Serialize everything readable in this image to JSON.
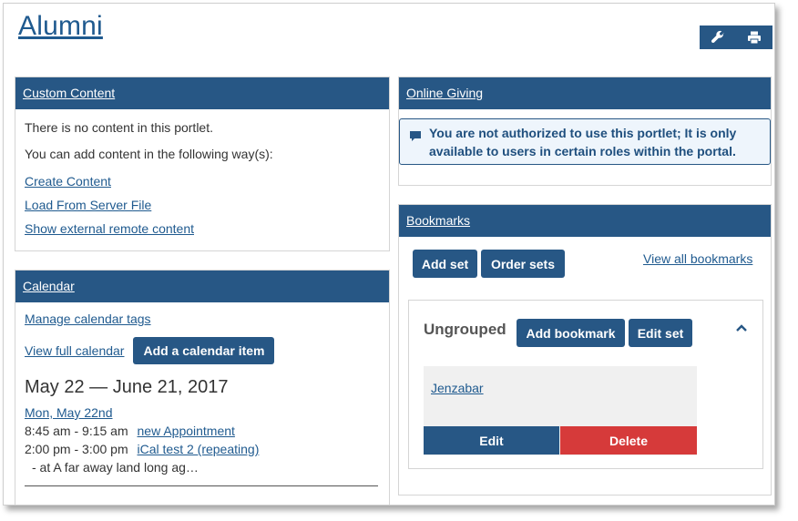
{
  "page": {
    "title": "Alumni"
  },
  "tools": {
    "wrench_icon": "wrench-icon",
    "print_icon": "print-icon"
  },
  "custom_content": {
    "header": "Custom Content",
    "no_content": "There is no content in this portlet.",
    "add_ways": "You can add content in the following way(s):",
    "links": [
      "Create Content",
      "Load From Server File",
      "Show external remote content"
    ]
  },
  "calendar": {
    "header": "Calendar",
    "manage_tags": "Manage calendar tags",
    "view_full": "View full calendar",
    "add_item": "Add a calendar item",
    "range": "May 22 — June 21, 2017",
    "day": "Mon, May 22nd",
    "events": [
      {
        "time": "8:45 am - 9:15 am",
        "title": "new Appointment",
        "location": ""
      },
      {
        "time": "2:00 pm - 3:00 pm",
        "title": "iCal test 2 (repeating)",
        "location": "- at A far away land long ag…"
      }
    ]
  },
  "online_giving": {
    "header": "Online Giving",
    "message": "You are not authorized to use this portlet; It is only available to users in certain roles within the portal."
  },
  "bookmarks": {
    "header": "Bookmarks",
    "add_set": "Add set",
    "order_sets": "Order sets",
    "view_all": "View all bookmarks",
    "group": {
      "name": "Ungrouped",
      "add_bookmark": "Add bookmark",
      "edit_set": "Edit set",
      "items": [
        {
          "label": "Jenzabar",
          "edit": "Edit",
          "delete": "Delete"
        }
      ]
    }
  },
  "colors": {
    "primary": "#275785",
    "link": "#1f5a8f",
    "danger": "#d63a3a",
    "alert_bg": "#eef5fc"
  }
}
